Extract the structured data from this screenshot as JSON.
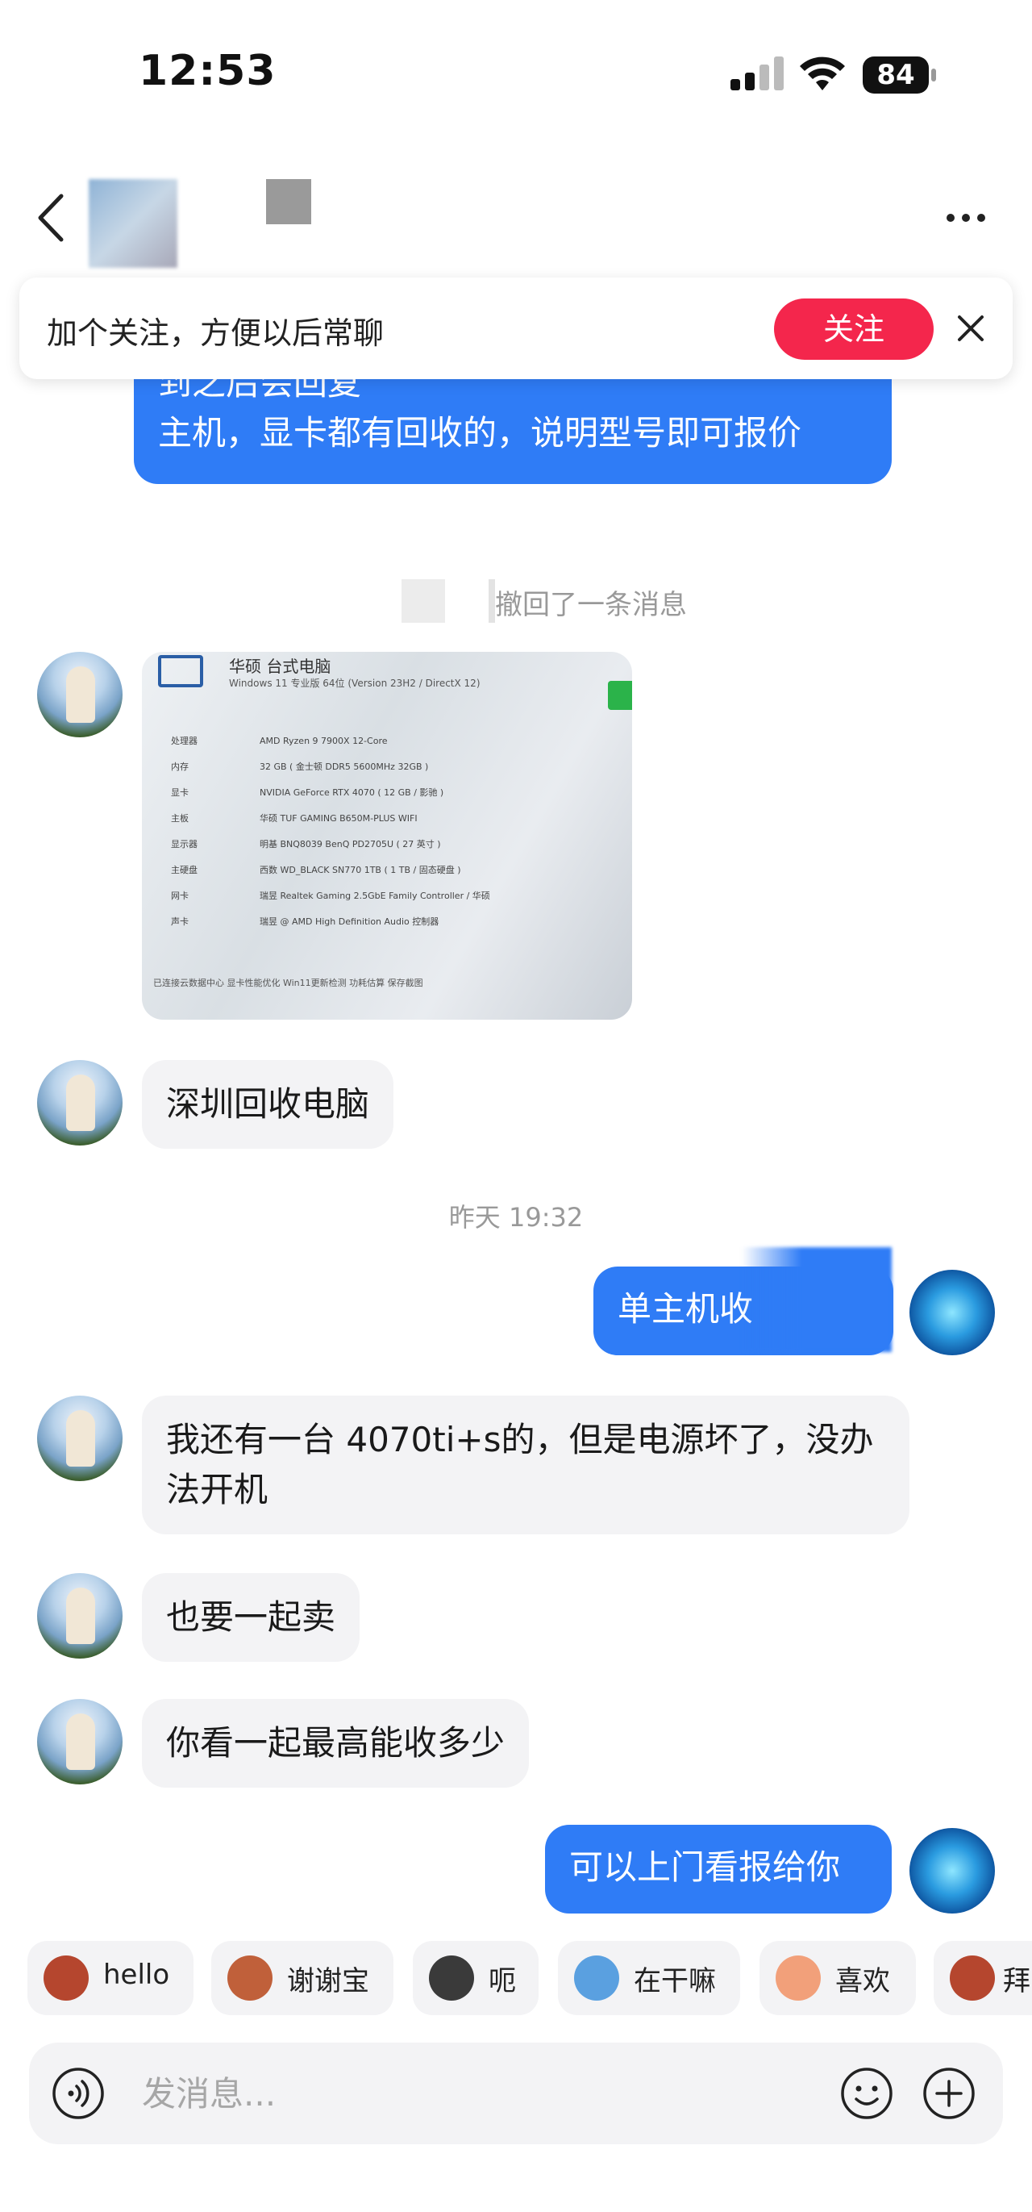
{
  "status_bar": {
    "time": "12:53",
    "battery": "84",
    "icons": [
      "signal-icon",
      "wifi-icon",
      "battery-icon"
    ]
  },
  "header": {
    "back_icon": "chevron-left-icon",
    "more_icon": "more-dots-icon"
  },
  "follow_banner": {
    "text": "加个关注，方便以后常聊",
    "button": "关注",
    "close_icon": "close-icon"
  },
  "messages": [
    {
      "type": "outgoing",
      "lines": [
        "到之后会回复",
        "主机，显卡都有回收的，说明型号即可报价"
      ]
    },
    {
      "type": "system",
      "text": "撤回了一条消息"
    },
    {
      "type": "incoming-image",
      "title": "华硕 台式电脑",
      "subtitle": "Windows 11 专业版 64位 (Version 23H2 / DirectX 12)",
      "specs": [
        [
          "处理器",
          "AMD Ryzen 9 7900X 12-Core"
        ],
        [
          "内存",
          "32 GB ( 金士顿 DDR5 5600MHz 32GB )"
        ],
        [
          "显卡",
          "NVIDIA GeForce RTX 4070 ( 12 GB / 影驰 )"
        ],
        [
          "主板",
          "华硕 TUF GAMING B650M-PLUS WIFI"
        ],
        [
          "显示器",
          "明基 BNQ8039 BenQ PD2705U ( 27 英寸 )"
        ],
        [
          "主硬盘",
          "西数 WD_BLACK SN770 1TB ( 1 TB / 固态硬盘 )"
        ],
        [
          "网卡",
          "瑞昱 Realtek Gaming 2.5GbE Family Controller / 华硕"
        ],
        [
          "声卡",
          "瑞昱 @ AMD High Definition Audio 控制器"
        ]
      ],
      "footer": "已连接云数据中心    显卡性能优化    Win11更新检测    功耗估算    保存截图"
    },
    {
      "type": "incoming",
      "text": "深圳回收电脑"
    },
    {
      "type": "timestamp",
      "text": "昨天 19:32"
    },
    {
      "type": "outgoing",
      "text": "单主机收"
    },
    {
      "type": "incoming",
      "text": "我还有一台 4070ti+s的，但是电源坏了，没办法开机"
    },
    {
      "type": "incoming",
      "text": "也要一起卖"
    },
    {
      "type": "incoming",
      "text": "你看一起最高能收多少"
    },
    {
      "type": "outgoing",
      "text": "可以上门看报给你"
    }
  ],
  "quick_replies": [
    {
      "label": "hello",
      "icon": "monkey-covering-eyes-icon",
      "color": "#b5462e"
    },
    {
      "label": "谢谢宝",
      "icon": "monkey-with-flower-icon",
      "color": "#c0603a"
    },
    {
      "label": "呃",
      "icon": "cat-face-icon",
      "color": "#3a3a3a"
    },
    {
      "label": "在干嘛",
      "icon": "cartoon-face-icon",
      "color": "#5aa0e0"
    },
    {
      "label": "喜欢",
      "icon": "blushing-face-icon",
      "color": "#f2a07a"
    },
    {
      "label": "拜",
      "icon": "monkey-wave-icon",
      "color": "#b5462e"
    }
  ],
  "input": {
    "placeholder": "发消息..."
  }
}
